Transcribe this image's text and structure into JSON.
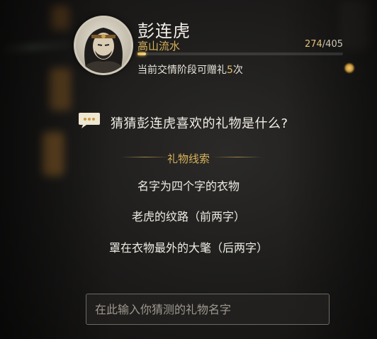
{
  "npc": {
    "name": "彭连虎",
    "rank": "高山流水",
    "friendship_current": "274",
    "friendship_total": "/405",
    "friendship_fraction": 0.04,
    "gift_prefix": "当前交情阶段可赠礼",
    "gift_count": "5",
    "gift_suffix": "次"
  },
  "question": "猜猜彭连虎喜欢的礼物是什么?",
  "clues": {
    "title": "礼物线索",
    "items": [
      "名字为四个字的衣物",
      "老虎的纹路（前两字）",
      "罩在衣物最外的大氅（后两字）"
    ]
  },
  "input": {
    "placeholder": "在此输入你猜测的礼物名字"
  },
  "colors": {
    "accent_gold": "#d8b35a",
    "bar_fill": "#e8b650"
  },
  "icons": [
    "portrait-avatar",
    "speech-bubble-icon"
  ]
}
